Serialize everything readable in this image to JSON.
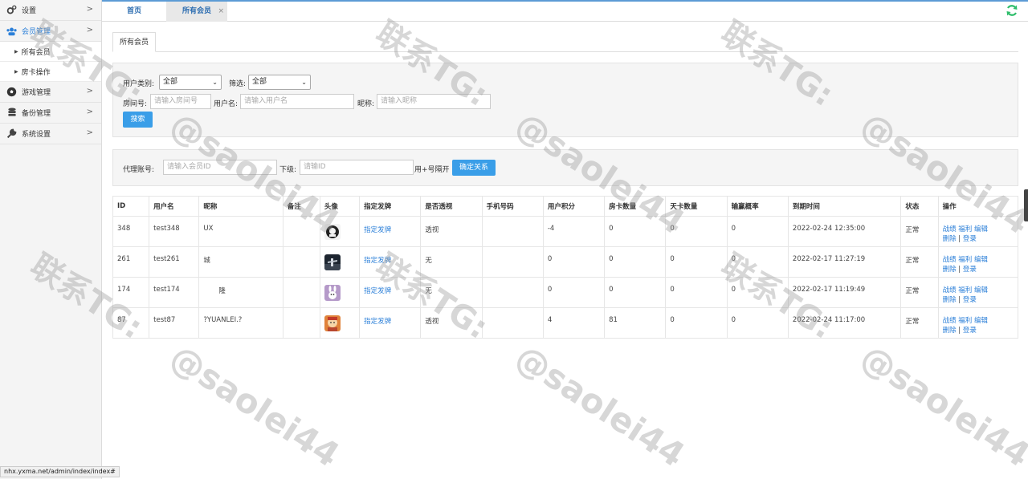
{
  "sidebar": {
    "items": [
      {
        "label": "设置",
        "icon": "gear-icon"
      },
      {
        "label": "会员管理",
        "icon": "users-icon"
      },
      {
        "label": "游戏管理",
        "icon": "soccer-ball-icon"
      },
      {
        "label": "备份管理",
        "icon": "database-icon"
      },
      {
        "label": "系统设置",
        "icon": "wrench-icon"
      }
    ],
    "subitems": [
      {
        "label": "所有会员"
      },
      {
        "label": "房卡操作"
      }
    ]
  },
  "tabs": {
    "home": "首页",
    "current": "所有会员",
    "close": "×"
  },
  "content": {
    "tab_label": "所有会员",
    "filter": {
      "user_type_label": "用户类别:",
      "user_type_value": "全部",
      "screen_label": "筛选:",
      "screen_value": "全部",
      "room_label": "房间号:",
      "room_placeholder": "请输入房间号",
      "username_label": "用户名:",
      "username_placeholder": "请输入用户名",
      "nickname_label": "昵称:",
      "nickname_placeholder": "请输入昵称",
      "search_button": "搜索"
    },
    "agent": {
      "agent_label": "代理账号:",
      "agent_placeholder": "请输入会员ID",
      "sub_label": "下级:",
      "sub_placeholder": "请输ID",
      "separator_hint": "用+号隔开",
      "confirm_button": "确定关系"
    }
  },
  "table": {
    "columns": [
      "ID",
      "用户名",
      "昵称",
      "备注",
      "头像",
      "指定发牌",
      "是否透视",
      "手机号码",
      "用户积分",
      "房卡数量",
      "天卡数量",
      "输赢概率",
      "到期时间",
      "状态",
      "操作"
    ],
    "rows": [
      {
        "id": "348",
        "username": "test348",
        "nickname": "UX",
        "note": "",
        "deal": "指定发牌",
        "see": "透视",
        "phone": "",
        "score": "-4",
        "roomcards": "0",
        "daycards": "0",
        "winrate": "0",
        "expire": "2022-02-24 12:35:00",
        "status": "正常"
      },
      {
        "id": "261",
        "username": "test261",
        "nickname": "城",
        "note": "",
        "deal": "指定发牌",
        "see": "无",
        "phone": "",
        "score": "0",
        "roomcards": "0",
        "daycards": "0",
        "winrate": "0",
        "expire": "2022-02-17 11:27:19",
        "status": "正常"
      },
      {
        "id": "174",
        "username": "test174",
        "nickname": "隆",
        "note": "",
        "deal": "指定发牌",
        "see": "无",
        "phone": "",
        "score": "0",
        "roomcards": "0",
        "daycards": "0",
        "winrate": "0",
        "expire": "2022-02-17 11:19:49",
        "status": "正常"
      },
      {
        "id": "87",
        "username": "test87",
        "nickname": "?YUANLEI.?",
        "note": "",
        "deal": "指定发牌",
        "see": "透视",
        "phone": "",
        "score": "4",
        "roomcards": "81",
        "daycards": "0",
        "winrate": "0",
        "expire": "2022-02-24 11:17:00",
        "status": "正常"
      }
    ],
    "ops": {
      "record": "战绩",
      "welfare": "福利",
      "edit": "编辑",
      "delete": "删除",
      "sep": "|",
      "login": "登录"
    }
  },
  "watermark": {
    "line1": "联系TG:",
    "line2": "@saolei44"
  },
  "statusbar": {
    "url": "nhx.yxma.net/admin/index/index#"
  },
  "colors": {
    "accent": "#3a9ee8",
    "link": "#2b7fd8",
    "refresh": "#2ebd6b"
  }
}
